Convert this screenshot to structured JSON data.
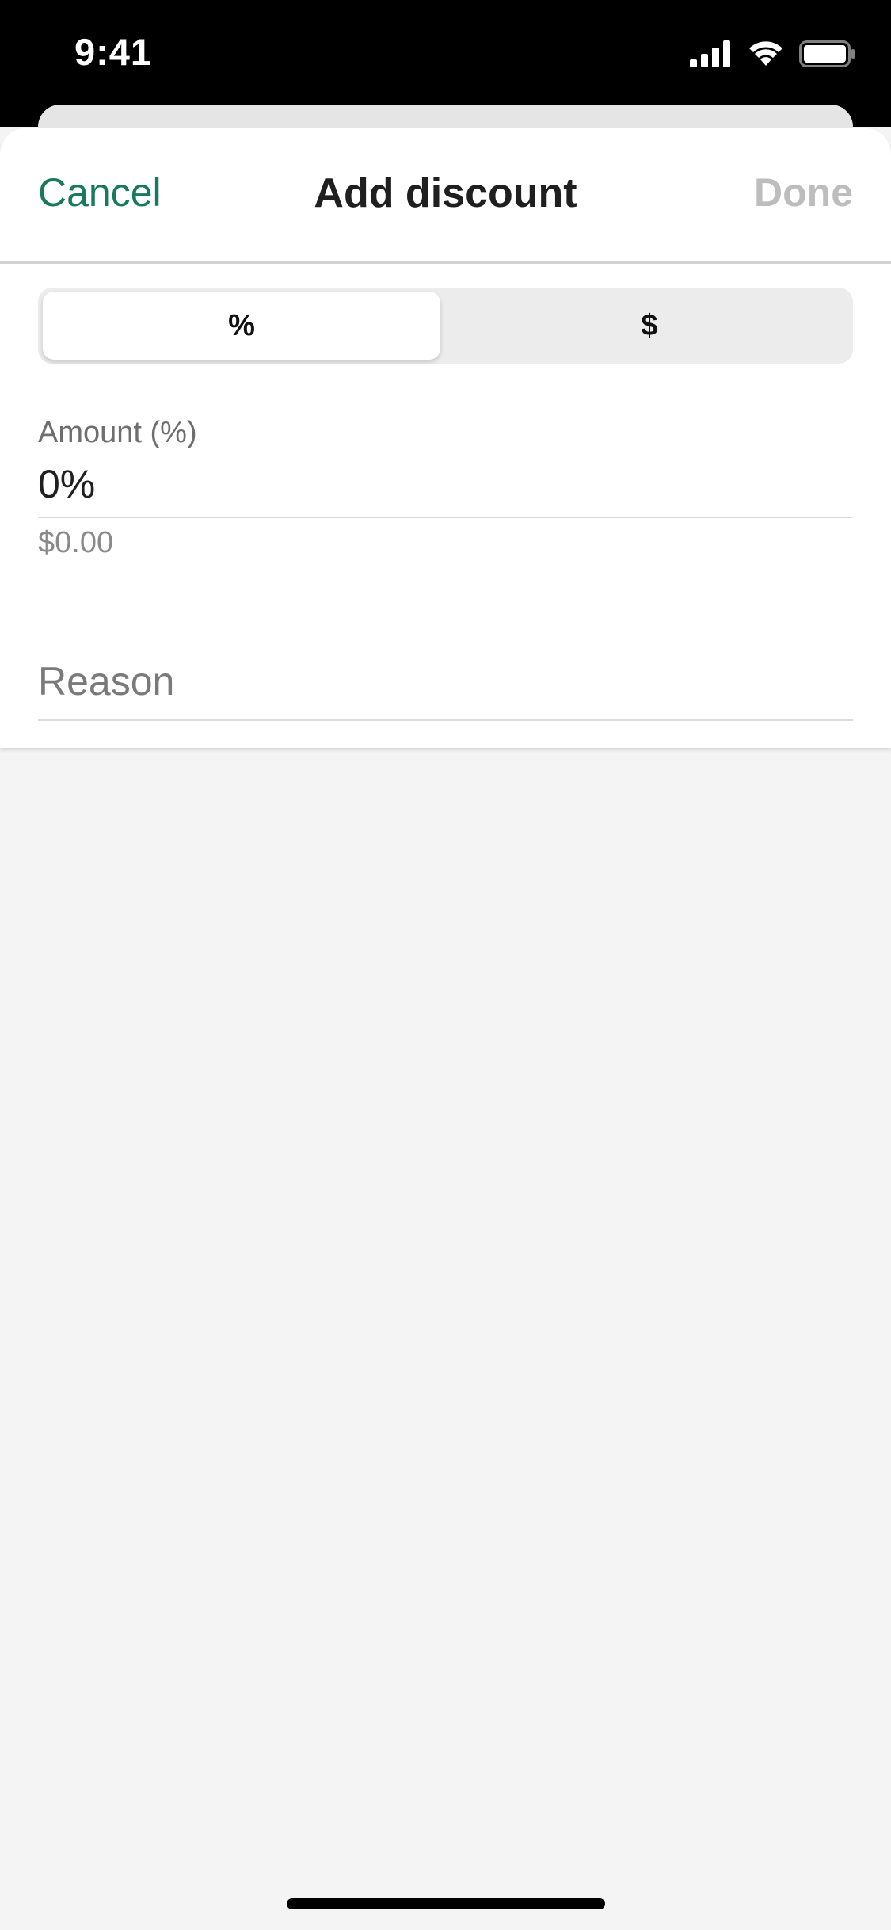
{
  "status_bar": {
    "time": "9:41"
  },
  "header": {
    "cancel_label": "Cancel",
    "title": "Add discount",
    "done_label": "Done"
  },
  "discount_type": {
    "options": [
      {
        "label": "%",
        "selected": true
      },
      {
        "label": "$",
        "selected": false
      }
    ]
  },
  "amount": {
    "label": "Amount (%)",
    "value": "0%",
    "converted": "$0.00"
  },
  "reason": {
    "placeholder": "Reason",
    "value": ""
  },
  "colors": {
    "accent": "#177a5b",
    "disabled": "#bdbdbd",
    "background": "#f4f4f4"
  },
  "icons": [
    "cellular-signal-icon",
    "wifi-icon",
    "battery-icon"
  ]
}
